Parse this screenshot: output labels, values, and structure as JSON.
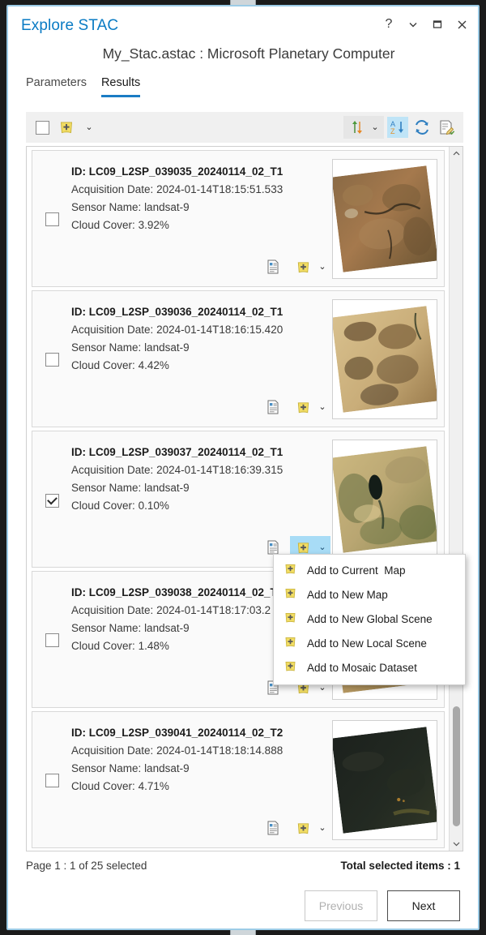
{
  "window": {
    "app_title": "Explore STAC",
    "controls": [
      {
        "name": "help",
        "glyph": "?"
      },
      {
        "name": "menu-chevron",
        "glyph": "⌄"
      },
      {
        "name": "maximize",
        "glyph": "□"
      },
      {
        "name": "close",
        "glyph": "✕"
      }
    ]
  },
  "document_title": "My_Stac.astac : Microsoft Planetary Computer",
  "tabs": [
    {
      "label": "Parameters",
      "active": false
    },
    {
      "label": "Results",
      "active": true
    }
  ],
  "toolbar": {
    "select_all_checked": false,
    "add_data_icon": "add-data-icon",
    "add_data_chevron": "⌄",
    "sort_direction_icon": "sort-updown-icon",
    "sort_direction_chevron": "⌄",
    "sort_az_icon": "sort-az-icon",
    "sort_az_active": true,
    "refresh_icon": "refresh-icon",
    "report_icon": "report-edit-icon"
  },
  "results": [
    {
      "checked": false,
      "id_label": "ID:",
      "id_value": "LC09_L2SP_039035_20240114_02_T1",
      "acquisition_label": "Acquisition Date:",
      "acquisition_value": "2024-01-14T18:15:51.533",
      "sensor_label": "Sensor Name:",
      "sensor_value": "landsat-9",
      "cloud_label": "Cloud Cover:",
      "cloud_value": "3.92%",
      "menu_open": false,
      "thumb_colors": [
        "#8a6a45",
        "#a5794d",
        "#6d5634",
        "#b98f5e",
        "#4e4230"
      ]
    },
    {
      "checked": false,
      "id_label": "ID:",
      "id_value": "LC09_L2SP_039036_20240114_02_T1",
      "acquisition_label": "Acquisition Date:",
      "acquisition_value": "2024-01-14T18:16:15.420",
      "sensor_label": "Sensor Name:",
      "sensor_value": "landsat-9",
      "cloud_label": "Cloud Cover:",
      "cloud_value": "4.42%",
      "menu_open": false,
      "thumb_colors": [
        "#d8c08d",
        "#9c7d4e",
        "#6b5334",
        "#c9ad79",
        "#5b4a2e"
      ]
    },
    {
      "checked": true,
      "id_label": "ID:",
      "id_value": "LC09_L2SP_039037_20240114_02_T1",
      "acquisition_label": "Acquisition Date:",
      "acquisition_value": "2024-01-14T18:16:39.315",
      "sensor_label": "Sensor Name:",
      "sensor_value": "landsat-9",
      "cloud_label": "Cloud Cover:",
      "cloud_value": "0.10%",
      "menu_open": true,
      "thumb_colors": [
        "#cbb77f",
        "#7d7b4a",
        "#55603a",
        "#d9c48f",
        "#1d2a24"
      ]
    },
    {
      "checked": false,
      "id_label": "ID:",
      "id_value": "LC09_L2SP_039038_20240114_02_T1",
      "acquisition_label": "Acquisition Date:",
      "acquisition_value": "2024-01-14T18:17:03.2",
      "sensor_label": "Sensor Name:",
      "sensor_value": "landsat-9",
      "cloud_label": "Cloud Cover:",
      "cloud_value": "1.48%",
      "menu_open": false,
      "thumb_colors": [
        "#b89a63",
        "#8a7344",
        "#6d5c38",
        "#c8ae77",
        "#4a3f28"
      ]
    },
    {
      "checked": false,
      "id_label": "ID:",
      "id_value": "LC09_L2SP_039041_20240114_02_T2",
      "acquisition_label": "Acquisition Date:",
      "acquisition_value": "2024-01-14T18:18:14.888",
      "sensor_label": "Sensor Name:",
      "sensor_value": "landsat-9",
      "cloud_label": "Cloud Cover:",
      "cloud_value": "4.71%",
      "menu_open": false,
      "thumb_colors": [
        "#1c211d",
        "#232a22",
        "#171c18",
        "#2c3326",
        "#3d4127"
      ]
    }
  ],
  "context_menu": {
    "items": [
      {
        "label": "Add to Current  Map",
        "icon": "add-data-icon"
      },
      {
        "label": "Add to New Map",
        "icon": "add-data-icon"
      },
      {
        "label": "Add to New Global Scene",
        "icon": "add-data-icon"
      },
      {
        "label": "Add to New Local Scene",
        "icon": "add-data-icon"
      },
      {
        "label": "Add to Mosaic Dataset",
        "icon": "add-data-icon"
      }
    ]
  },
  "footer": {
    "page_info": "Page 1 : 1 of 25 selected",
    "total_info": "Total selected items : 1",
    "previous_label": "Previous",
    "previous_enabled": false,
    "next_label": "Next",
    "next_enabled": true
  },
  "colors": {
    "accent_blue": "#1a7cc4",
    "title_blue": "#0a7bc4",
    "highlight_blue": "#a8dcf6",
    "panel_border": "#9ccbe6",
    "icon_yellow": "#f2dd63"
  }
}
